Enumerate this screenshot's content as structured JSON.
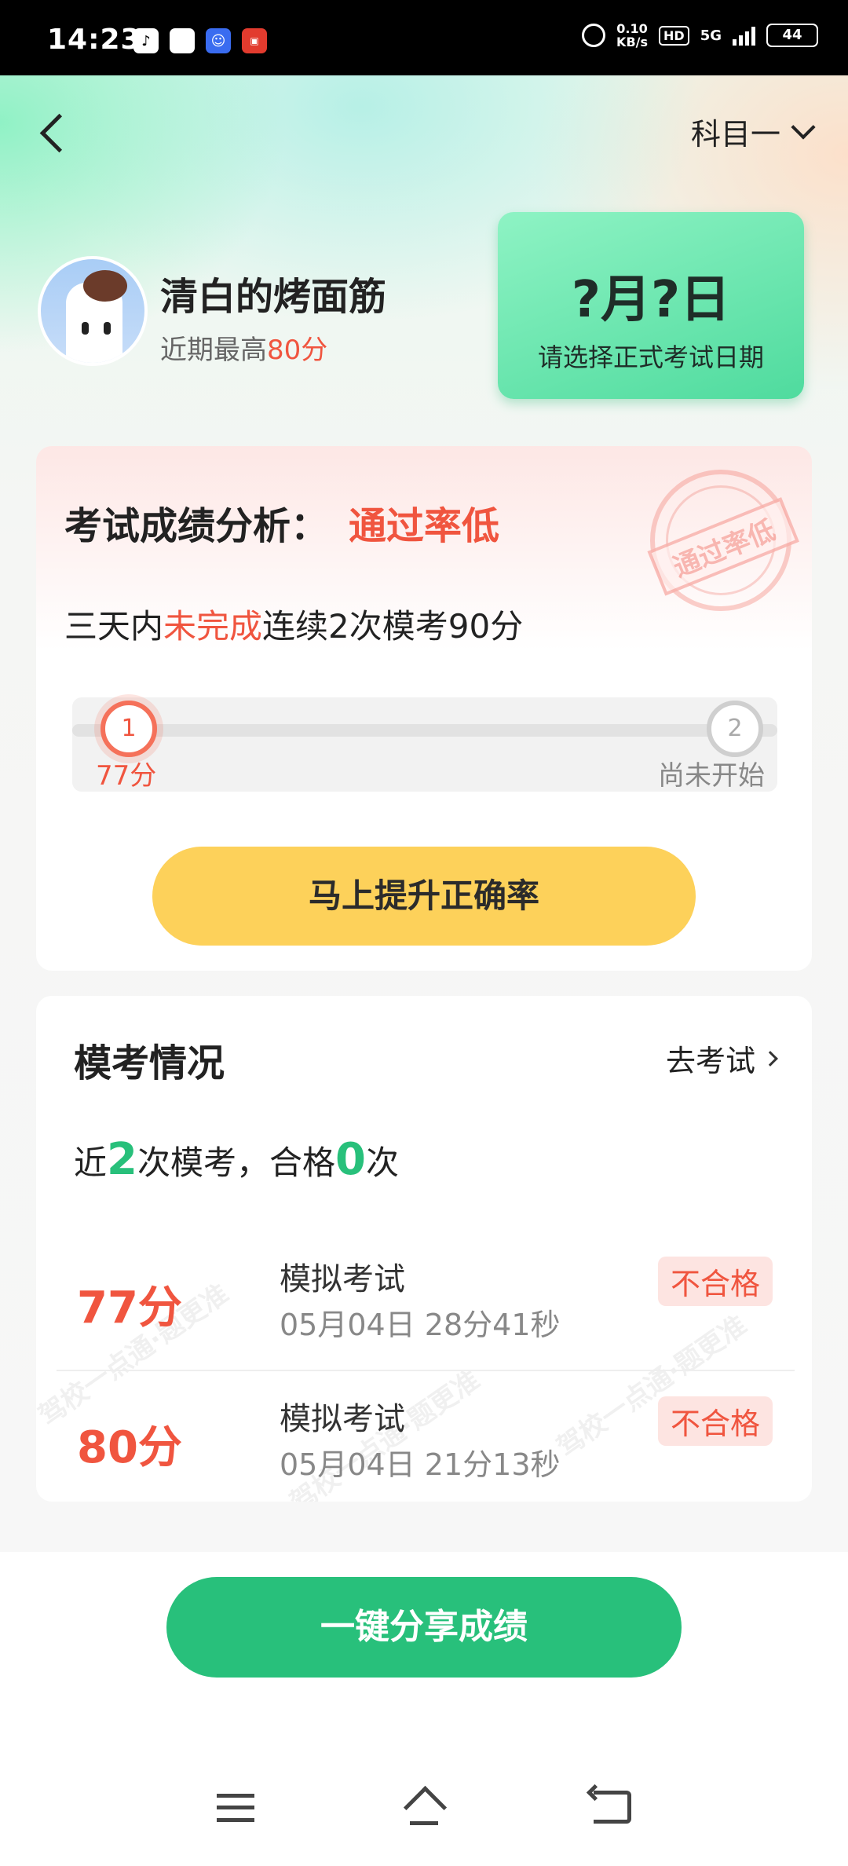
{
  "status_bar": {
    "time": "14:23",
    "net_speed_value": "0.10",
    "net_speed_unit": "KB/s",
    "hd": "HD",
    "network": "5G",
    "battery": "44"
  },
  "header": {
    "subject": "科目一"
  },
  "profile": {
    "name": "清白的烤面筋",
    "best_prefix": "近期最高",
    "best_score": "80分"
  },
  "exam_date": {
    "main": "?月?日",
    "sub": "请选择正式考试日期"
  },
  "analysis": {
    "title": "考试成绩分析：",
    "status": "通过率低",
    "stamp": "通过率低",
    "requirement_prefix": "三天内",
    "requirement_highlight": "未完成",
    "requirement_suffix": "连续2次模考90分",
    "steps": [
      {
        "index": "1",
        "label": "77分",
        "state": "done"
      },
      {
        "index": "2",
        "label": "尚未开始",
        "state": "pending"
      }
    ],
    "action_label": "马上提升正确率"
  },
  "mock_exams": {
    "title": "模考情况",
    "go_label": "去考试",
    "summary_a": "近",
    "summary_count": "2",
    "summary_b": "次模考，合格",
    "summary_pass": "0",
    "summary_c": "次",
    "rows": [
      {
        "score": "77分",
        "name": "模拟考试",
        "time": "05月04日 28分41秒",
        "result": "不合格"
      },
      {
        "score": "80分",
        "name": "模拟考试",
        "time": "05月04日 21分13秒",
        "result": "不合格"
      }
    ],
    "watermark": "驾校一点通·题更准"
  },
  "share": {
    "label": "一键分享成绩"
  },
  "colors": {
    "accent_green": "#28c07b",
    "accent_red": "#f0553f",
    "button_yellow": "#fdd15a"
  }
}
